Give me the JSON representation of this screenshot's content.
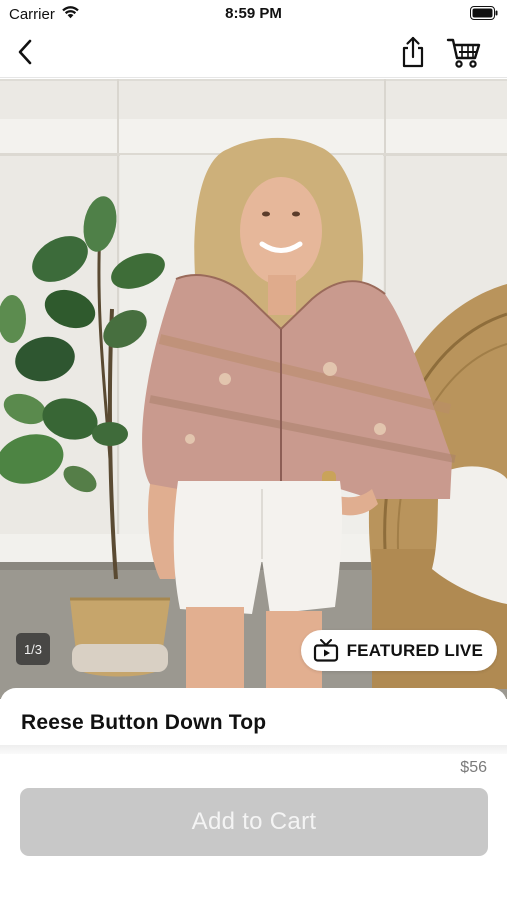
{
  "status_bar": {
    "carrier": "Carrier",
    "time": "8:59 PM",
    "icons": [
      "wifi-icon",
      "battery-icon"
    ]
  },
  "nav": {
    "icons": [
      "chevron-left-icon",
      "share-icon",
      "cart-icon"
    ]
  },
  "product_image": {
    "page_indicator": "1/3",
    "current_page": 1,
    "total_pages": 3
  },
  "badge": {
    "label": "FEATURED LIVE",
    "icon": "tv-icon"
  },
  "product": {
    "title": "Reese Button Down Top",
    "price": "$56"
  },
  "actions": {
    "add_to_cart_label": "Add to Cart"
  },
  "colors": {
    "button_disabled": "#c8c8c8",
    "price_text": "#7b7b7b"
  }
}
